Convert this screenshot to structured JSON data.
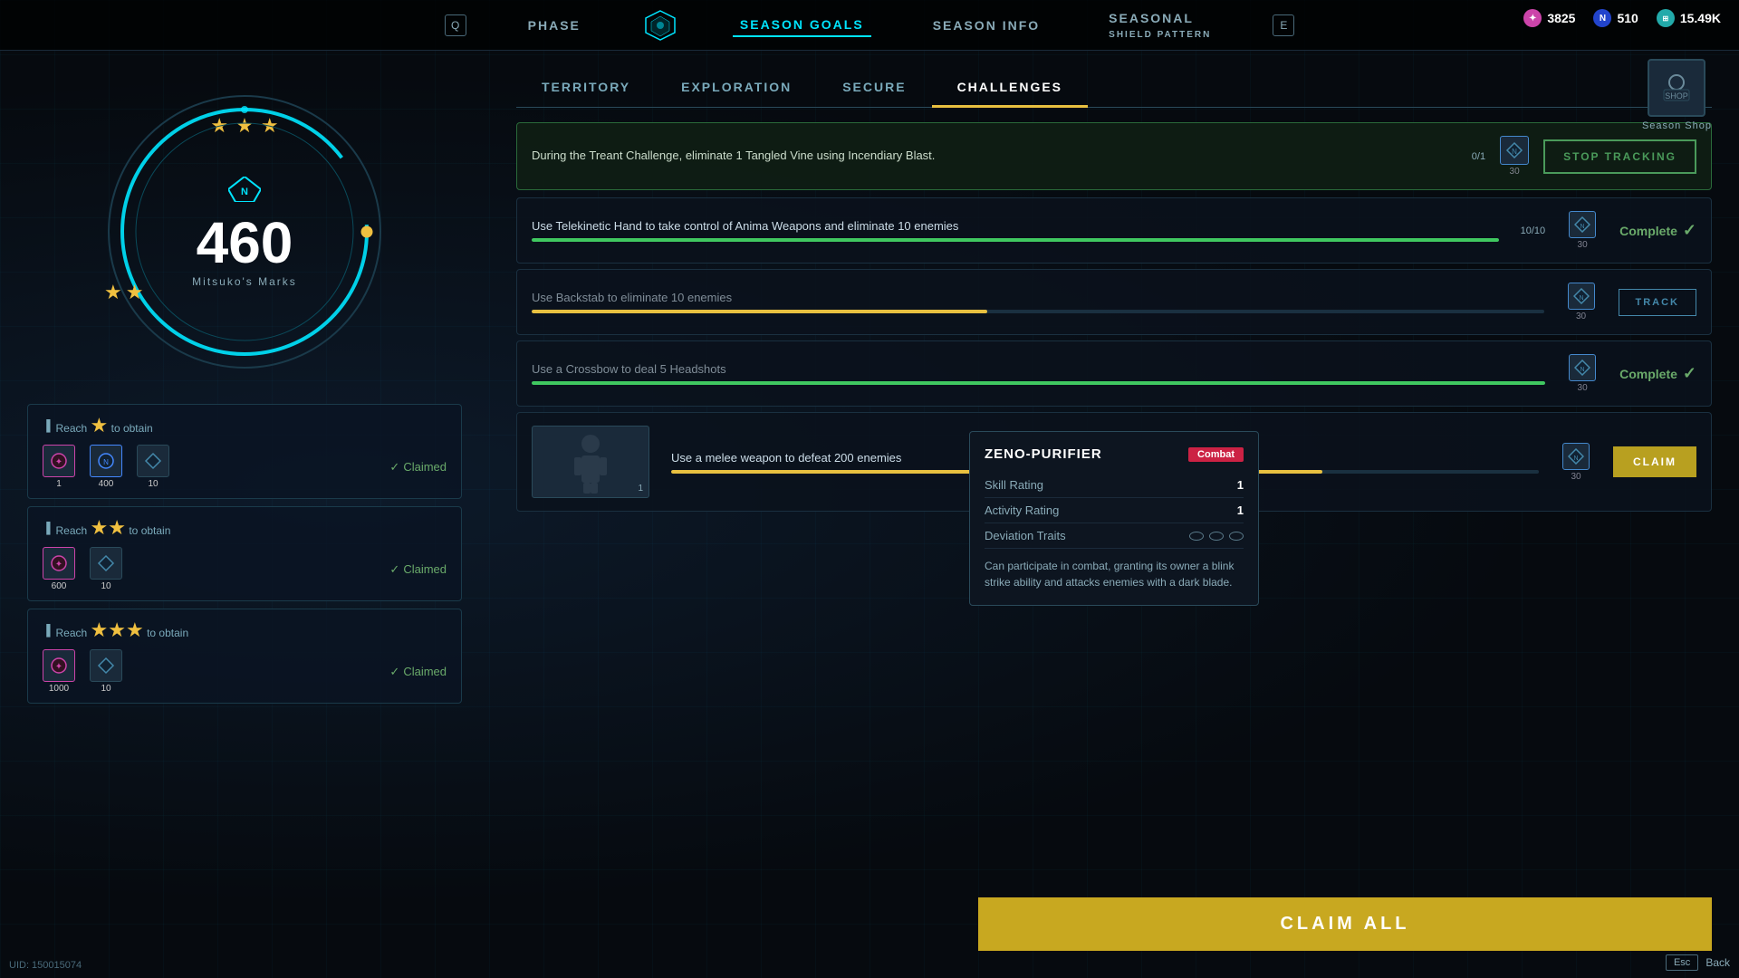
{
  "nav": {
    "phase_key": "Q",
    "phase_label": "PHASE",
    "season_goals_label": "SEASON GOALS",
    "season_info_label": "SEASON INFO",
    "seasonal_label": "SEASONAL",
    "shield_pattern_label": "SHIELD PATTERN",
    "e_key": "E"
  },
  "currency": {
    "pink_amount": "3825",
    "blue_amount": "510",
    "green_amount": "15.49K"
  },
  "season_shop": {
    "label": "Season Shop"
  },
  "character": {
    "marks_value": "460",
    "marks_label": "Mitsuko's Marks"
  },
  "stars": {
    "top_filled": 3,
    "bottom_left_filled": 2
  },
  "milestones": [
    {
      "header": "Reach ☆ to obtain",
      "rewards": [
        {
          "type": "pink",
          "count": "1"
        },
        {
          "type": "blue",
          "count": "400"
        },
        {
          "type": "shards",
          "count": "10"
        }
      ],
      "status": "Claimed"
    },
    {
      "header": "Reach ☆☆ to obtain",
      "rewards": [
        {
          "type": "pink",
          "count": "600"
        },
        {
          "type": "shards",
          "count": "10"
        }
      ],
      "status": "Claimed"
    },
    {
      "header": "Reach ☆☆☆ to obtain",
      "rewards": [
        {
          "type": "pink",
          "count": "1000"
        },
        {
          "type": "shards",
          "count": "10"
        }
      ],
      "status": "Claimed"
    }
  ],
  "tabs": {
    "territory": "TERRITORY",
    "exploration": "EXPLORATION",
    "secure": "SECURE",
    "challenges": "CHALLENGES"
  },
  "tracking_challenge": {
    "text": "During the Treant Challenge, eliminate 1 Tangled Vine using Incendiary Blast.",
    "progress": "0/1",
    "reward_count": "30",
    "stop_tracking_label": "STOP TRACKING"
  },
  "challenges": [
    {
      "title": "Use Telekinetic Hand to take control of Anima Weapons and eliminate 10 enemies",
      "progress_pct": 100,
      "progress_text": "10/10",
      "reward_count": "30",
      "action": "Complete",
      "action_type": "complete"
    },
    {
      "title": "Use Backstab to eliminate 10 enemies",
      "progress_pct": 45,
      "progress_text": "",
      "reward_count": "30",
      "action": "TRACK",
      "action_type": "track"
    },
    {
      "title": "Use a Crossbow to deal 5 Headshots",
      "progress_pct": 100,
      "progress_text": "",
      "reward_count": "30",
      "action": "Complete",
      "action_type": "complete"
    },
    {
      "title": "Use a melee weapon to defeat 200 enemies",
      "progress_pct": 75,
      "progress_text": "",
      "reward_count": "30",
      "reward_item": "1",
      "action": "CLAIM",
      "action_type": "claim"
    }
  ],
  "tooltip": {
    "title": "ZENO-PURIFIER",
    "combat_badge": "Combat",
    "skill_rating_label": "Skill Rating",
    "skill_rating_value": "1",
    "activity_rating_label": "Activity Rating",
    "activity_rating_value": "1",
    "deviation_traits_label": "Deviation Traits",
    "description": "Can participate in combat, granting its owner a blink strike ability and attacks enemies with a dark blade."
  },
  "claim_all_label": "CLAIM ALL",
  "uid": "UID: 150015074",
  "esc_label": "Esc",
  "back_label": "Back"
}
